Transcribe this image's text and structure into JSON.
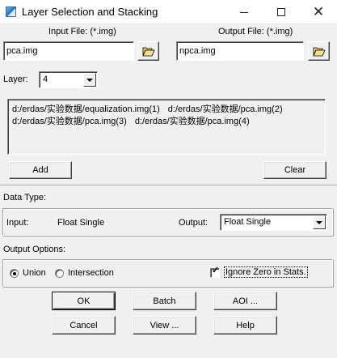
{
  "window": {
    "title": "Layer Selection and Stacking",
    "icons": {
      "app": "erdas-app-icon",
      "minimize": "minimize-icon",
      "maximize": "maximize-icon",
      "close": "close-icon"
    }
  },
  "input_file": {
    "label": "Input File: (*.img)",
    "value": "pca.img",
    "browse_icon": "folder-open-icon"
  },
  "output_file": {
    "label": "Output File: (*.img)",
    "value": "npca.img",
    "browse_icon": "folder-open-icon"
  },
  "layer": {
    "label": "Layer:",
    "value": "4"
  },
  "layer_list": {
    "lines": [
      [
        "d:/erdas/实验数据/equalization.img(1)",
        "d:/erdas/实验数据/pca.img(2)"
      ],
      [
        "d:/erdas/实验数据/pca.img(3)",
        "d:/erdas/实验数据/pca.img(4)"
      ]
    ]
  },
  "buttons": {
    "add": "Add",
    "clear": "Clear",
    "ok": "OK",
    "batch": "Batch",
    "aoi": "AOI ...",
    "cancel": "Cancel",
    "view": "View ...",
    "help": "Help"
  },
  "data_type": {
    "section_label": "Data Type:",
    "input_label": "Input:",
    "input_value": "Float Single",
    "output_label": "Output:",
    "output_value": "Float Single"
  },
  "output_options": {
    "section_label": "Output Options:",
    "union_label": "Union",
    "intersection_label": "Intersection",
    "selected": "Union",
    "ignore_zero_label": "Ignore Zero in Stats.",
    "ignore_zero_checked": true
  }
}
